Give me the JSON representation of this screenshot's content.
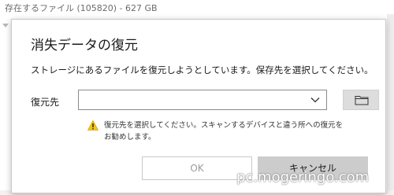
{
  "background": {
    "title": "存在するファイル (105820) - 627 GB"
  },
  "dialog": {
    "title": "消失データの復元",
    "description": "ストレージにあるファイルを復元しようとしています。保存先を選択してください。",
    "destination_label": "復元先",
    "destination_value": "",
    "warning_line1": "復元先を選択してください。スキャンするデバイスと違う所への復元を",
    "warning_line2": "お勧めします。",
    "ok_label": "OK",
    "cancel_label": "キャンセル"
  },
  "icons": {
    "dropdown": "chevron-down-icon",
    "browse": "folder-icon",
    "warning": "warning-icon"
  },
  "watermark": {
    "text": "pc.mogeringo.com"
  }
}
